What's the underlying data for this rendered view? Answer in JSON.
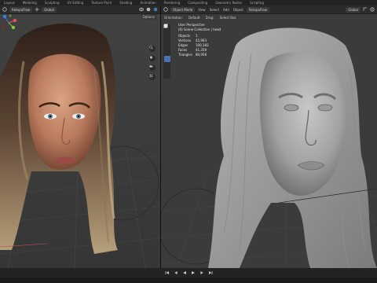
{
  "workspace_tabs": [
    "Layout",
    "Modeling",
    "Sculpting",
    "UV Editing",
    "Texture Paint",
    "Shading",
    "Animation",
    "Rendering",
    "Compositing",
    "Geometry Nodes",
    "Scripting"
  ],
  "left_header": {
    "transform": "RetopoFlow",
    "orientation_mode": "Global",
    "options_label": "Options"
  },
  "right_header": {
    "mode": "Object Mode",
    "view": "View",
    "select": "Select",
    "add": "Add",
    "object": "Object",
    "addon": "RetopoFlow",
    "orientation_mode": "Global",
    "orientation_label": "Orientation:",
    "orientation_value": "Default",
    "drag_label": "Drag:",
    "drag_value": "Select Box"
  },
  "viewport_info": {
    "view_name": "User Perspective",
    "collection": "(0) Scene Collection | head",
    "stats": [
      {
        "label": "Objects",
        "value": "1"
      },
      {
        "label": "Vertices",
        "value": "42,963"
      },
      {
        "label": "Edges",
        "value": "100,183"
      },
      {
        "label": "Faces",
        "value": "41,359"
      },
      {
        "label": "Triangles",
        "value": "80,958"
      }
    ]
  },
  "icons": {
    "tools": [
      "cursor-icon",
      "move-icon",
      "rotate-icon",
      "scale-icon",
      "transform-icon",
      "annotate-icon",
      "measure-icon"
    ],
    "nav": [
      "zoom-icon",
      "hand-icon",
      "camera-icon",
      "grid-icon"
    ],
    "playback": [
      "jump-start-icon",
      "step-back-icon",
      "reverse-play-icon",
      "play-icon",
      "step-forward-icon",
      "jump-end-icon"
    ]
  },
  "colors": {
    "accent": "#4772b3",
    "axis_x": "#e2505a",
    "axis_y": "#8acb2f",
    "axis_z": "#3d7ce0",
    "skin": "#c98f6f",
    "clay": "#a8a8a8",
    "hair_dark": "#3a2a22",
    "hair_light": "#b8a27e"
  }
}
